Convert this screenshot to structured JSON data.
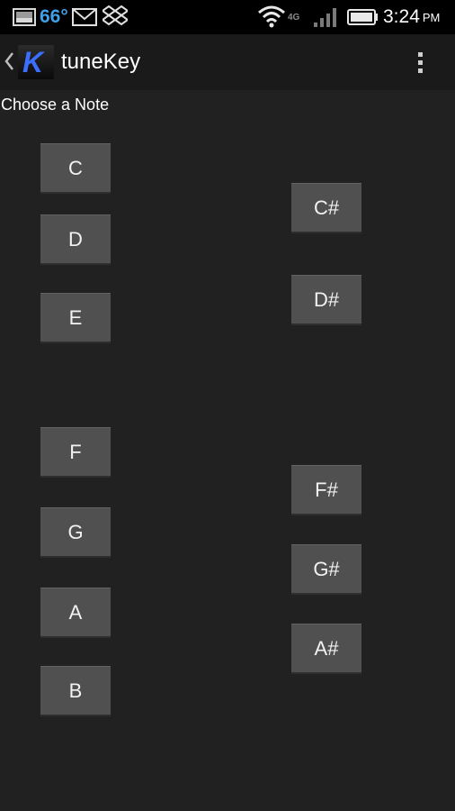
{
  "status_bar": {
    "temperature": "66°",
    "network": "4G",
    "time": "3:24",
    "ampm": "PM"
  },
  "action_bar": {
    "title": "tuneKey",
    "icon_letter": "K"
  },
  "prompt": "Choose a Note",
  "notes": {
    "natural": [
      "C",
      "D",
      "E",
      "F",
      "G",
      "A",
      "B"
    ],
    "sharp": [
      "C#",
      "D#",
      "F#",
      "G#",
      "A#"
    ]
  },
  "icons": [
    "image-icon",
    "gmail-icon",
    "dropbox-icon",
    "wifi-icon",
    "signal-icon",
    "battery-icon",
    "back-chevron-icon",
    "overflow-menu-icon"
  ]
}
